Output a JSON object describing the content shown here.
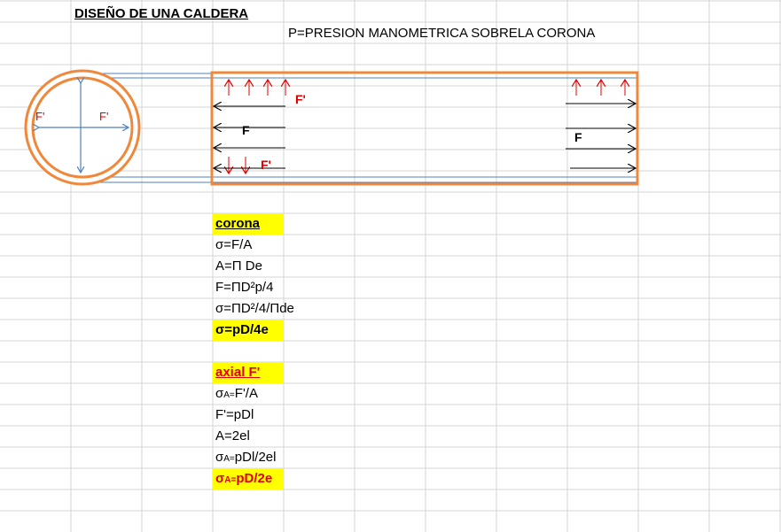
{
  "sheet": {
    "title": "DISEÑO DE UNA CALDERA",
    "subtitle": "P=PRESION MANOMETRICA SOBRELA CORONA"
  },
  "diagram": {
    "circle_labels": [
      "F'",
      "F'"
    ],
    "force_labels": {
      "f_prime_top": "F'",
      "f_left": "F",
      "f_prime_bottom": "F'",
      "f_right": "F"
    },
    "colors": {
      "shell": "#f0883c",
      "lines": "#4f81bd",
      "arrows_red": "#e00000",
      "arrows_black": "#000000"
    }
  },
  "corona": {
    "header": "corona",
    "lines": [
      "σ=F/A",
      "A=Π De",
      "F=ΠD²p/4",
      "σ=ΠD²/4/Πde"
    ],
    "result": "σ=pD/4e"
  },
  "axial": {
    "header": "axial  F'",
    "line1_prefix": "σ",
    "line1_sub": "A=",
    "line1_suffix": "F'/A",
    "line2": "F'=pDl",
    "line3": "A=2el",
    "line4_prefix": "σ",
    "line4_sub": "A=",
    "line4_suffix": "pDl/2el",
    "result_prefix": "σ",
    "result_sub": "A=",
    "result_suffix": "pD/2e"
  }
}
